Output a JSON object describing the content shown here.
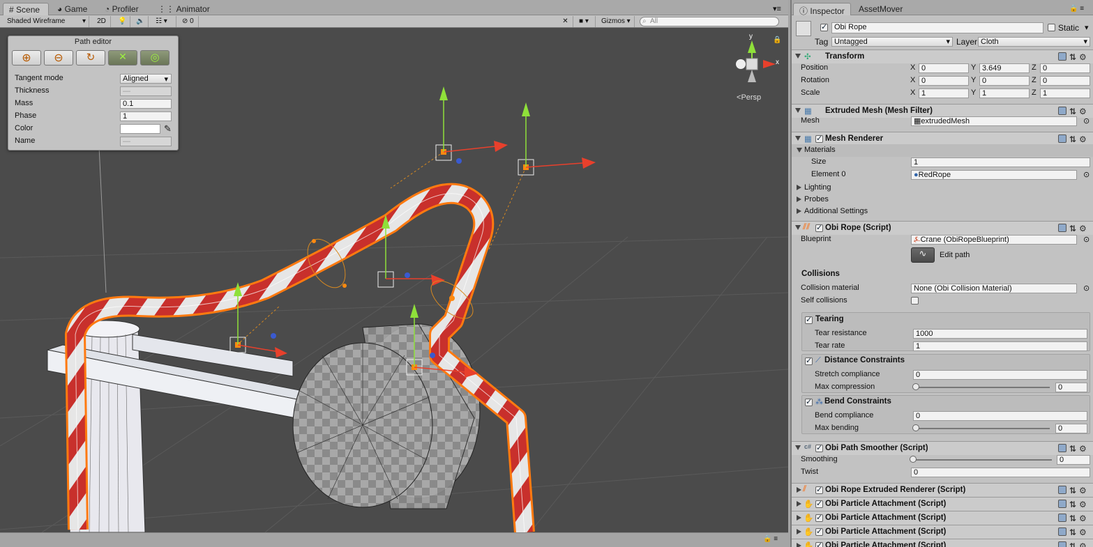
{
  "scene_tabs": [
    {
      "label": "Scene",
      "icon": "grid-icon",
      "active": true
    },
    {
      "label": "Game",
      "icon": "pacman-icon",
      "active": false
    },
    {
      "label": "Profiler",
      "icon": "profiler-icon",
      "active": false
    },
    {
      "label": "Animator",
      "icon": "animator-icon",
      "active": false
    }
  ],
  "toolbar": {
    "draw_mode": "Shaded Wireframe",
    "mode_2d": "2D",
    "hidden_count": "0",
    "gizmos": "Gizmos",
    "search_placeholder": "All"
  },
  "scene_view": {
    "axis_y": "y",
    "axis_x": "x",
    "projection": "Persp"
  },
  "path_editor": {
    "title": "Path editor",
    "buttons": [
      "add-point-icon",
      "remove-point-icon",
      "close-loop-icon",
      "transform-icon",
      "orient-icon"
    ],
    "fields": [
      {
        "label": "Tangent mode",
        "value": "Aligned",
        "type": "dropdown"
      },
      {
        "label": "Thickness",
        "value": "—",
        "type": "disabled"
      },
      {
        "label": "Mass",
        "value": "0.1",
        "type": "text"
      },
      {
        "label": "Phase",
        "value": "1",
        "type": "text"
      },
      {
        "label": "Color",
        "value": "",
        "type": "color"
      },
      {
        "label": "Name",
        "value": "—",
        "type": "disabled"
      }
    ]
  },
  "inspector": {
    "tabs": [
      {
        "label": "Inspector",
        "active": true
      },
      {
        "label": "AssetMover",
        "active": false
      }
    ],
    "object_name": "Obi Rope",
    "object_enabled": true,
    "static_label": "Static",
    "tag_label": "Tag",
    "tag_value": "Untagged",
    "layer_label": "Layer",
    "layer_value": "Cloth",
    "transform": {
      "title": "Transform",
      "rows": [
        {
          "label": "Position",
          "x": "0",
          "y": "3.649",
          "z": "0"
        },
        {
          "label": "Rotation",
          "x": "0",
          "y": "0",
          "z": "0"
        },
        {
          "label": "Scale",
          "x": "1",
          "y": "1",
          "z": "1"
        }
      ]
    },
    "mesh_filter": {
      "title": "Extruded Mesh (Mesh Filter)",
      "mesh_label": "Mesh",
      "mesh_value": "extrudedMesh"
    },
    "mesh_renderer": {
      "title": "Mesh Renderer",
      "materials_label": "Materials",
      "size_label": "Size",
      "size_value": "1",
      "element_label": "Element 0",
      "element_value": "RedRope",
      "lighting": "Lighting",
      "probes": "Probes",
      "additional": "Additional Settings"
    },
    "obi_rope": {
      "title": "Obi Rope (Script)",
      "blueprint_label": "Blueprint",
      "blueprint_value": "Crane (ObiRopeBlueprint)",
      "edit_path": "Edit path",
      "collisions_title": "Collisions",
      "collision_material_label": "Collision material",
      "collision_material_value": "None (Obi Collision Material)",
      "self_collisions_label": "Self collisions",
      "self_collisions": false,
      "tearing": {
        "title": "Tearing",
        "enabled": true,
        "resistance_label": "Tear resistance",
        "resistance": "1000",
        "rate_label": "Tear rate",
        "rate": "1"
      },
      "distance": {
        "title": "Distance Constraints",
        "enabled": true,
        "stretch_label": "Stretch compliance",
        "stretch": "0",
        "maxcomp_label": "Max compression",
        "maxcomp": "0"
      },
      "bend": {
        "title": "Bend Constraints",
        "enabled": true,
        "compliance_label": "Bend compliance",
        "compliance": "0",
        "maxbend_label": "Max bending",
        "maxbend": "0"
      }
    },
    "smoother": {
      "title": "Obi Path Smoother (Script)",
      "smoothing_label": "Smoothing",
      "smoothing": "0",
      "twist_label": "Twist",
      "twist": "0"
    },
    "collapsed_components": [
      "Obi Rope Extruded Renderer (Script)",
      "Obi Particle Attachment (Script)",
      "Obi Particle Attachment (Script)",
      "Obi Particle Attachment (Script)",
      "Obi Particle Attachment (Script)"
    ]
  },
  "colors": {
    "rope_red": "#c8302c",
    "rope_white": "#e8e8e8",
    "selection_orange": "#ff7a10",
    "axis_y_green": "#8fe03a",
    "axis_x_red": "#e8402c",
    "scene_bg": "#4b4b4b"
  }
}
